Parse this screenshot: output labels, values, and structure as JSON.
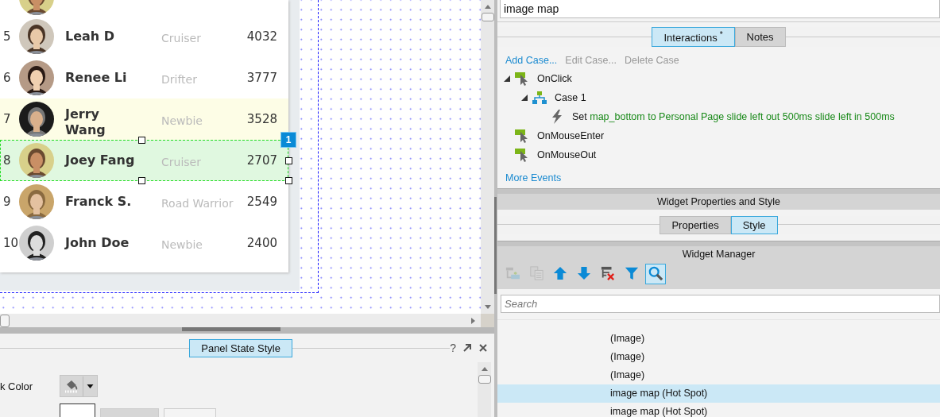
{
  "canvas": {
    "rows": [
      {
        "rank": "5",
        "name": "Leah D",
        "role": "Cruiser",
        "score": "4032",
        "hovered": false,
        "selected": false
      },
      {
        "rank": "6",
        "name": "Renee Li",
        "role": "Drifter",
        "score": "3777",
        "hovered": false,
        "selected": false
      },
      {
        "rank": "7",
        "name": "Jerry Wang",
        "role": "Newbie",
        "score": "3528",
        "hovered": true,
        "selected": false
      },
      {
        "rank": "8",
        "name": "Joey Fang",
        "role": "Cruiser",
        "score": "2707",
        "hovered": false,
        "selected": true
      },
      {
        "rank": "9",
        "name": "Franck S.",
        "role": "Road Warrior",
        "score": "2549",
        "hovered": false,
        "selected": false
      },
      {
        "rank": "10",
        "name": "John Doe",
        "role": "Newbie",
        "score": "2400",
        "hovered": false,
        "selected": false
      }
    ],
    "selection_badge": "1"
  },
  "interactions": {
    "widget_name": "image map",
    "tabs": [
      {
        "label": "Interactions",
        "marker": "*",
        "selected": true
      },
      {
        "label": "Notes",
        "selected": false
      }
    ],
    "actions": [
      {
        "label": "Add Case...",
        "disabled": false
      },
      {
        "label": "Edit Case...",
        "disabled": true
      },
      {
        "label": "Delete Case",
        "disabled": true
      }
    ],
    "events": [
      {
        "kind": "event",
        "label": "OnClick",
        "expanded": true,
        "children": [
          {
            "kind": "case",
            "label": "Case 1",
            "expanded": true,
            "children": [
              {
                "kind": "action",
                "label": "Set",
                "detail": "map_bottom to Personal Page slide left out 500ms slide left in 500ms"
              }
            ]
          }
        ]
      },
      {
        "kind": "event",
        "label": "OnMouseEnter"
      },
      {
        "kind": "event",
        "label": "OnMouseOut"
      }
    ],
    "more_link": "More Events"
  },
  "properties": {
    "title": "Widget Properties and Style",
    "tabs": [
      {
        "label": "Properties",
        "selected": false
      },
      {
        "label": "Style",
        "selected": true
      }
    ]
  },
  "widget_manager": {
    "title": "Widget Manager",
    "tools": [
      {
        "kind": "add",
        "disabled": true,
        "active": false
      },
      {
        "kind": "copy",
        "disabled": true,
        "active": false
      },
      {
        "kind": "up",
        "disabled": false,
        "active": false
      },
      {
        "kind": "down",
        "disabled": false,
        "active": false
      },
      {
        "kind": "delete",
        "disabled": false,
        "active": false
      },
      {
        "kind": "filter",
        "disabled": false,
        "active": false
      },
      {
        "kind": "search",
        "disabled": false,
        "active": true
      }
    ],
    "search": {
      "placeholder": "Search"
    },
    "items": [
      {
        "label": "(Image)",
        "selected": false
      },
      {
        "label": "(Image)",
        "selected": false
      },
      {
        "label": "(Image)",
        "selected": false
      },
      {
        "label": "image map (Hot Spot)",
        "selected": true
      },
      {
        "label": "image map (Hot Spot)",
        "selected": false
      }
    ]
  },
  "bottom_panel": {
    "tabs": [
      {
        "label": "Panel State Style",
        "selected": true
      }
    ],
    "help": "?",
    "field_label": "k Color"
  }
}
